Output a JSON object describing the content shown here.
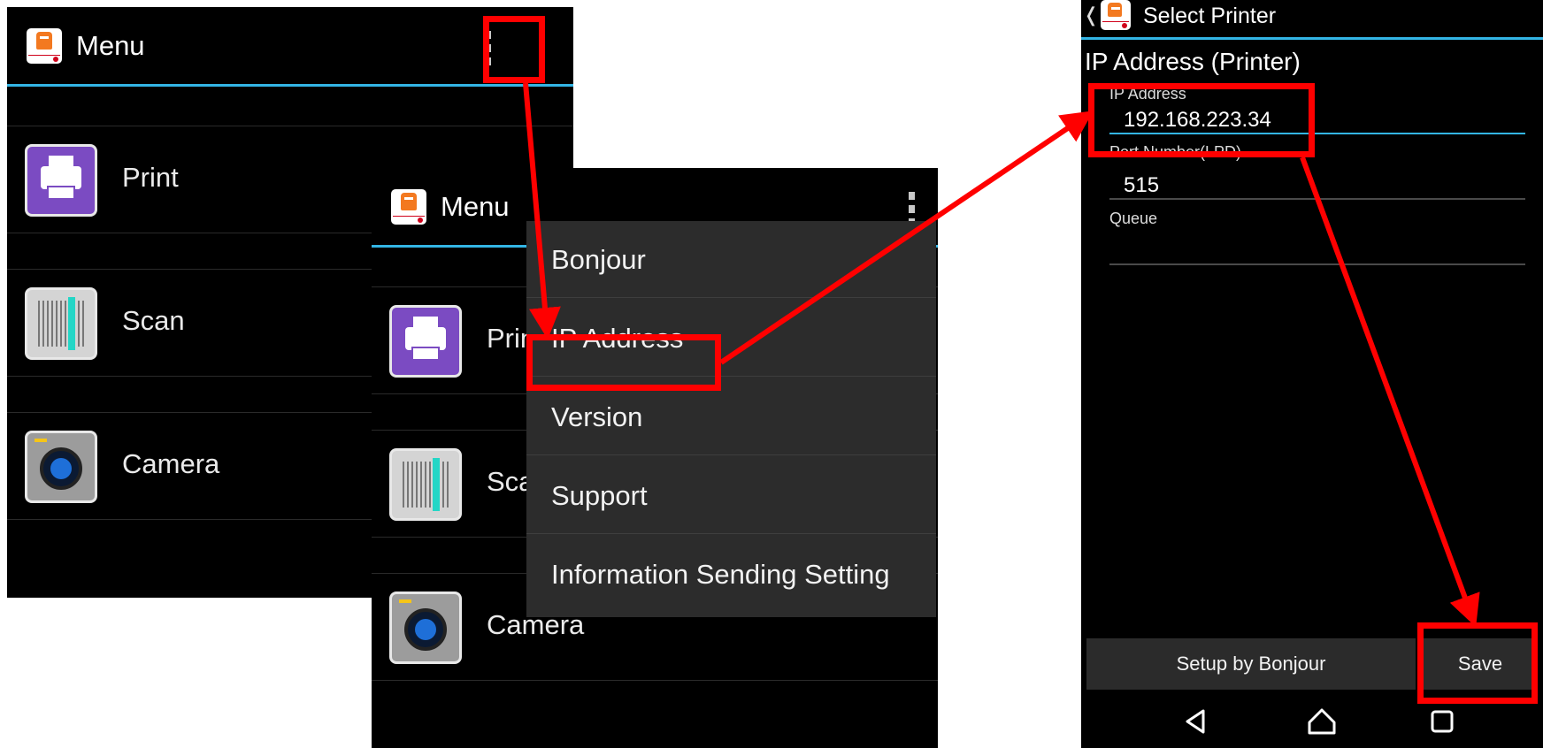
{
  "screen1": {
    "title": "Menu",
    "items": [
      {
        "label": "Print",
        "icon": "print-icon"
      },
      {
        "label": "Scan",
        "icon": "scan-icon"
      },
      {
        "label": "Camera",
        "icon": "camera-icon"
      }
    ]
  },
  "screen2": {
    "title": "Menu",
    "items": [
      {
        "label": "Print",
        "icon": "print-icon"
      },
      {
        "label": "Scan",
        "icon": "scan-icon"
      },
      {
        "label": "Camera",
        "icon": "camera-icon"
      }
    ],
    "overflow_menu": [
      "Bonjour",
      "IP Address",
      "Version",
      "Support",
      "Information Sending Setting"
    ]
  },
  "screen3": {
    "back_glyph": "❬",
    "title": "Select Printer",
    "section_title": "IP Address (Printer)",
    "fields": [
      {
        "label": "IP Address",
        "value": "192.168.223.34",
        "active": true
      },
      {
        "label": "Port Number(LPD)",
        "value": "515",
        "active": false
      },
      {
        "label": "Queue",
        "value": "",
        "active": false
      }
    ],
    "buttons": {
      "setup_bonjour": "Setup by Bonjour",
      "save": "Save"
    },
    "navbar": {
      "back": "back-icon",
      "home": "home-icon",
      "recent": "recent-apps-icon"
    }
  },
  "colors": {
    "accent": "#33b5e5",
    "annotation": "#ff0000",
    "brand_orange": "#f37920",
    "print_tile": "#7b4bc2",
    "menu_bg": "#2c2c2c"
  }
}
